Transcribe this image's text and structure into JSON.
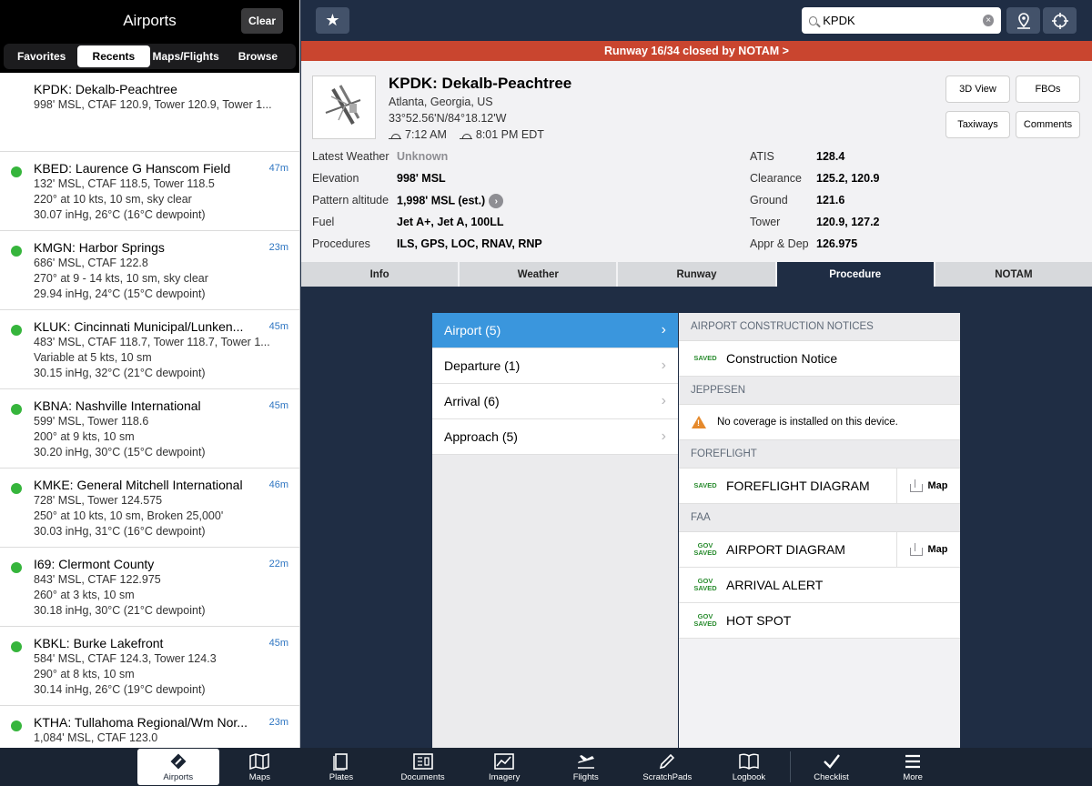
{
  "left": {
    "title": "Airports",
    "clear_label": "Clear",
    "segments": [
      "Favorites",
      "Recents",
      "Maps/Flights",
      "Browse"
    ],
    "airports": [
      {
        "name": "KPDK: Dekalb-Peachtree",
        "age": "",
        "lines": [
          "998' MSL, CTAF 120.9, Tower 120.9, Tower 1..."
        ],
        "dot": false
      },
      {
        "name": "KBED: Laurence G Hanscom Field",
        "age": "47m",
        "lines": [
          "132' MSL, CTAF 118.5, Tower 118.5",
          "220° at 10 kts, 10 sm, sky clear",
          "30.07 inHg, 26°C (16°C dewpoint)"
        ],
        "dot": true
      },
      {
        "name": "KMGN: Harbor Springs",
        "age": "23m",
        "lines": [
          "686' MSL, CTAF 122.8",
          "270° at 9 - 14 kts, 10 sm, sky clear",
          "29.94 inHg, 24°C (15°C dewpoint)"
        ],
        "dot": true
      },
      {
        "name": "KLUK: Cincinnati Municipal/Lunken...",
        "age": "45m",
        "lines": [
          "483' MSL, CTAF 118.7, Tower 118.7, Tower 1...",
          "Variable at 5 kts, 10 sm",
          "30.15 inHg, 32°C (21°C dewpoint)"
        ],
        "dot": true
      },
      {
        "name": "KBNA: Nashville International",
        "age": "45m",
        "lines": [
          "599' MSL, Tower 118.6",
          "200° at 9 kts, 10 sm",
          "30.20 inHg, 30°C (15°C dewpoint)"
        ],
        "dot": true
      },
      {
        "name": "KMKE: General Mitchell International",
        "age": "46m",
        "lines": [
          "728' MSL, Tower 124.575",
          "250° at 10 kts, 10 sm, Broken 25,000'",
          "30.03 inHg, 31°C (16°C dewpoint)"
        ],
        "dot": true
      },
      {
        "name": "I69: Clermont County",
        "age": "22m",
        "lines": [
          "843' MSL, CTAF 122.975",
          "260° at 3 kts, 10 sm",
          "30.18 inHg, 30°C (21°C dewpoint)"
        ],
        "dot": true
      },
      {
        "name": "KBKL: Burke Lakefront",
        "age": "45m",
        "lines": [
          "584' MSL, CTAF 124.3, Tower 124.3",
          "290° at 8 kts, 10 sm",
          "30.14 inHg, 26°C (19°C dewpoint)"
        ],
        "dot": true
      },
      {
        "name": "KTHA: Tullahoma Regional/Wm Nor...",
        "age": "23m",
        "lines": [
          "1,084' MSL, CTAF 123.0"
        ],
        "dot": true
      }
    ]
  },
  "topbar": {
    "search_value": "KPDK",
    "star_icon": "star-icon",
    "pin_icon": "map-pin-icon",
    "locate_icon": "crosshair-icon"
  },
  "banner": "Runway 16/34 closed by NOTAM >",
  "airport": {
    "title": "KPDK: Dekalb-Peachtree",
    "city": "Atlanta, Georgia, US",
    "coords": "33°52.56'N/84°18.12'W",
    "sunrise": "7:12 AM",
    "sunset": "8:01 PM EDT",
    "buttons": {
      "view3d": "3D View",
      "fbos": "FBOs",
      "taxiways": "Taxiways",
      "comments": "Comments"
    },
    "left_info": [
      {
        "k": "Latest Weather",
        "v": "Unknown",
        "muted": true
      },
      {
        "k": "Elevation",
        "v": "998' MSL"
      },
      {
        "k": "Pattern altitude",
        "v": "1,998' MSL (est.)"
      },
      {
        "k": "Fuel",
        "v": "Jet A+, Jet A, 100LL"
      },
      {
        "k": "Procedures",
        "v": "ILS, GPS, LOC, RNAV, RNP"
      }
    ],
    "right_info": [
      {
        "k": "ATIS",
        "v": "128.4"
      },
      {
        "k": "Clearance",
        "v": "125.2, 120.9"
      },
      {
        "k": "Ground",
        "v": "121.6"
      },
      {
        "k": "Tower",
        "v": "120.9, 127.2"
      },
      {
        "k": "Appr & Dep",
        "v": "126.975"
      }
    ]
  },
  "tabs": [
    "Info",
    "Weather",
    "Runway",
    "Procedure",
    "NOTAM"
  ],
  "active_tab": "Procedure",
  "procedures": [
    {
      "label": "Airport (5)",
      "active": true
    },
    {
      "label": "Departure (1)"
    },
    {
      "label": "Arrival (6)"
    },
    {
      "label": "Approach (5)"
    }
  ],
  "docs": {
    "sec_construction": "AIRPORT CONSTRUCTION NOTICES",
    "construction_badge": "SAVED",
    "construction_name": "Construction Notice",
    "sec_jeppesen": "JEPPESEN",
    "jeppesen_msg": "No coverage is installed on this device.",
    "sec_foreflight": "FOREFLIGHT",
    "ff_badge": "SAVED",
    "ff_name": "FOREFLIGHT DIAGRAM",
    "map_label": "Map",
    "sec_faa": "FAA",
    "gov": "GOV",
    "saved": "SAVED",
    "faa_items": [
      "AIRPORT DIAGRAM",
      "ARRIVAL ALERT",
      "HOT SPOT"
    ]
  },
  "nav": [
    "Airports",
    "Maps",
    "Plates",
    "Documents",
    "Imagery",
    "Flights",
    "ScratchPads",
    "Logbook",
    "Checklist",
    "More"
  ],
  "colors": {
    "accent": "#3a96dd",
    "banner": "#c9452f",
    "dark": "#1f2d44",
    "good": "#36b53c"
  }
}
